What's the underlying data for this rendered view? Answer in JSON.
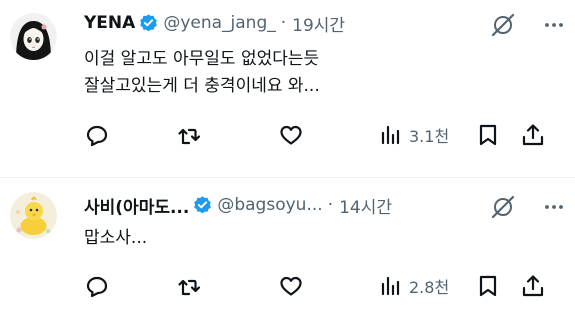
{
  "colors": {
    "verified": "#1d9bf0",
    "muted": "#536471",
    "text": "#0f1419",
    "divider": "#eff3f4"
  },
  "tweets": [
    {
      "display_name": "YENA",
      "handle": "@yena_jang_",
      "separator": "·",
      "time": "19시간",
      "text": "이걸 알고도 아무일도 없었다는듯\n잘살고있는게 더 충격이네요 와...",
      "views": "3.1천"
    },
    {
      "display_name": "사비(아마도...",
      "handle": "@bagsoyu...",
      "separator": "·",
      "time": "14시간",
      "text": "맙소사...",
      "views": "2.8천"
    }
  ]
}
